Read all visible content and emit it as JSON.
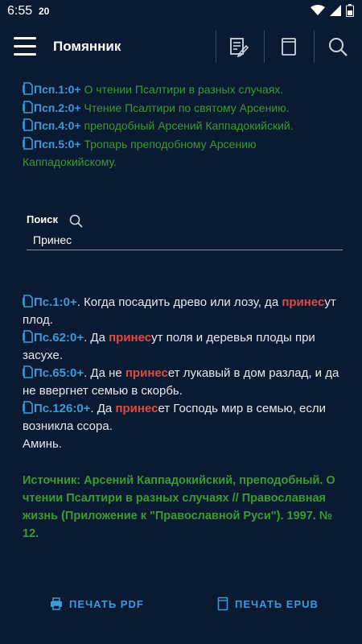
{
  "status": {
    "time": "6:55",
    "badge": "20"
  },
  "header": {
    "title": "Помянник"
  },
  "links": [
    {
      "ref": "Псп.1:0+",
      "text": " О чтении Псалтири в разных случаях."
    },
    {
      "ref": "Псп.2:0+",
      "text": " Чтение Псалтири по святому Арсению."
    },
    {
      "ref": "Псп.4:0+",
      "text": " преподобный Арсений Каппадокийский."
    },
    {
      "ref": "Псп.5:0+",
      "text": " Тропарь преподобному Арсению Каппадокийскому."
    }
  ],
  "search": {
    "label": "Поиск",
    "value": "Принес"
  },
  "results": [
    {
      "ref": "Пс.1:0+",
      "pre": ". Когда посадить древо или лозу, да ",
      "hl": "принес",
      "post": "ут плод."
    },
    {
      "ref": "Пс.62:0+",
      "pre": ". Да ",
      "hl": "принес",
      "post": "ут поля и деревья плоды при засухе."
    },
    {
      "ref": "Пс.65:0+",
      "pre": ". Да не ",
      "hl": "принес",
      "post": "ет лукавый в дом разлад, и да не ввергнет семью в скорбь."
    },
    {
      "ref": "Пс.126:0+",
      "pre": ". Да ",
      "hl": "принес",
      "post": "ет Господь мир в семью, если возникла ссора."
    }
  ],
  "amen": "Аминь.",
  "source": "Источник: Арсений Каппадокийский, преподобный. О чтении Псалтири в разных случаях // Православная жизнь (Приложение к \"Православной Руси\"). 1997. № 12.",
  "footer": {
    "pdf_label": "ПЕЧАТЬ PDF",
    "epub_label": "ПЕЧАТЬ EPUB"
  },
  "colors": {
    "background": "#0b1a33",
    "accent": "#3a9bd8",
    "green": "#3c9b2f",
    "highlight": "#e04a3f"
  }
}
